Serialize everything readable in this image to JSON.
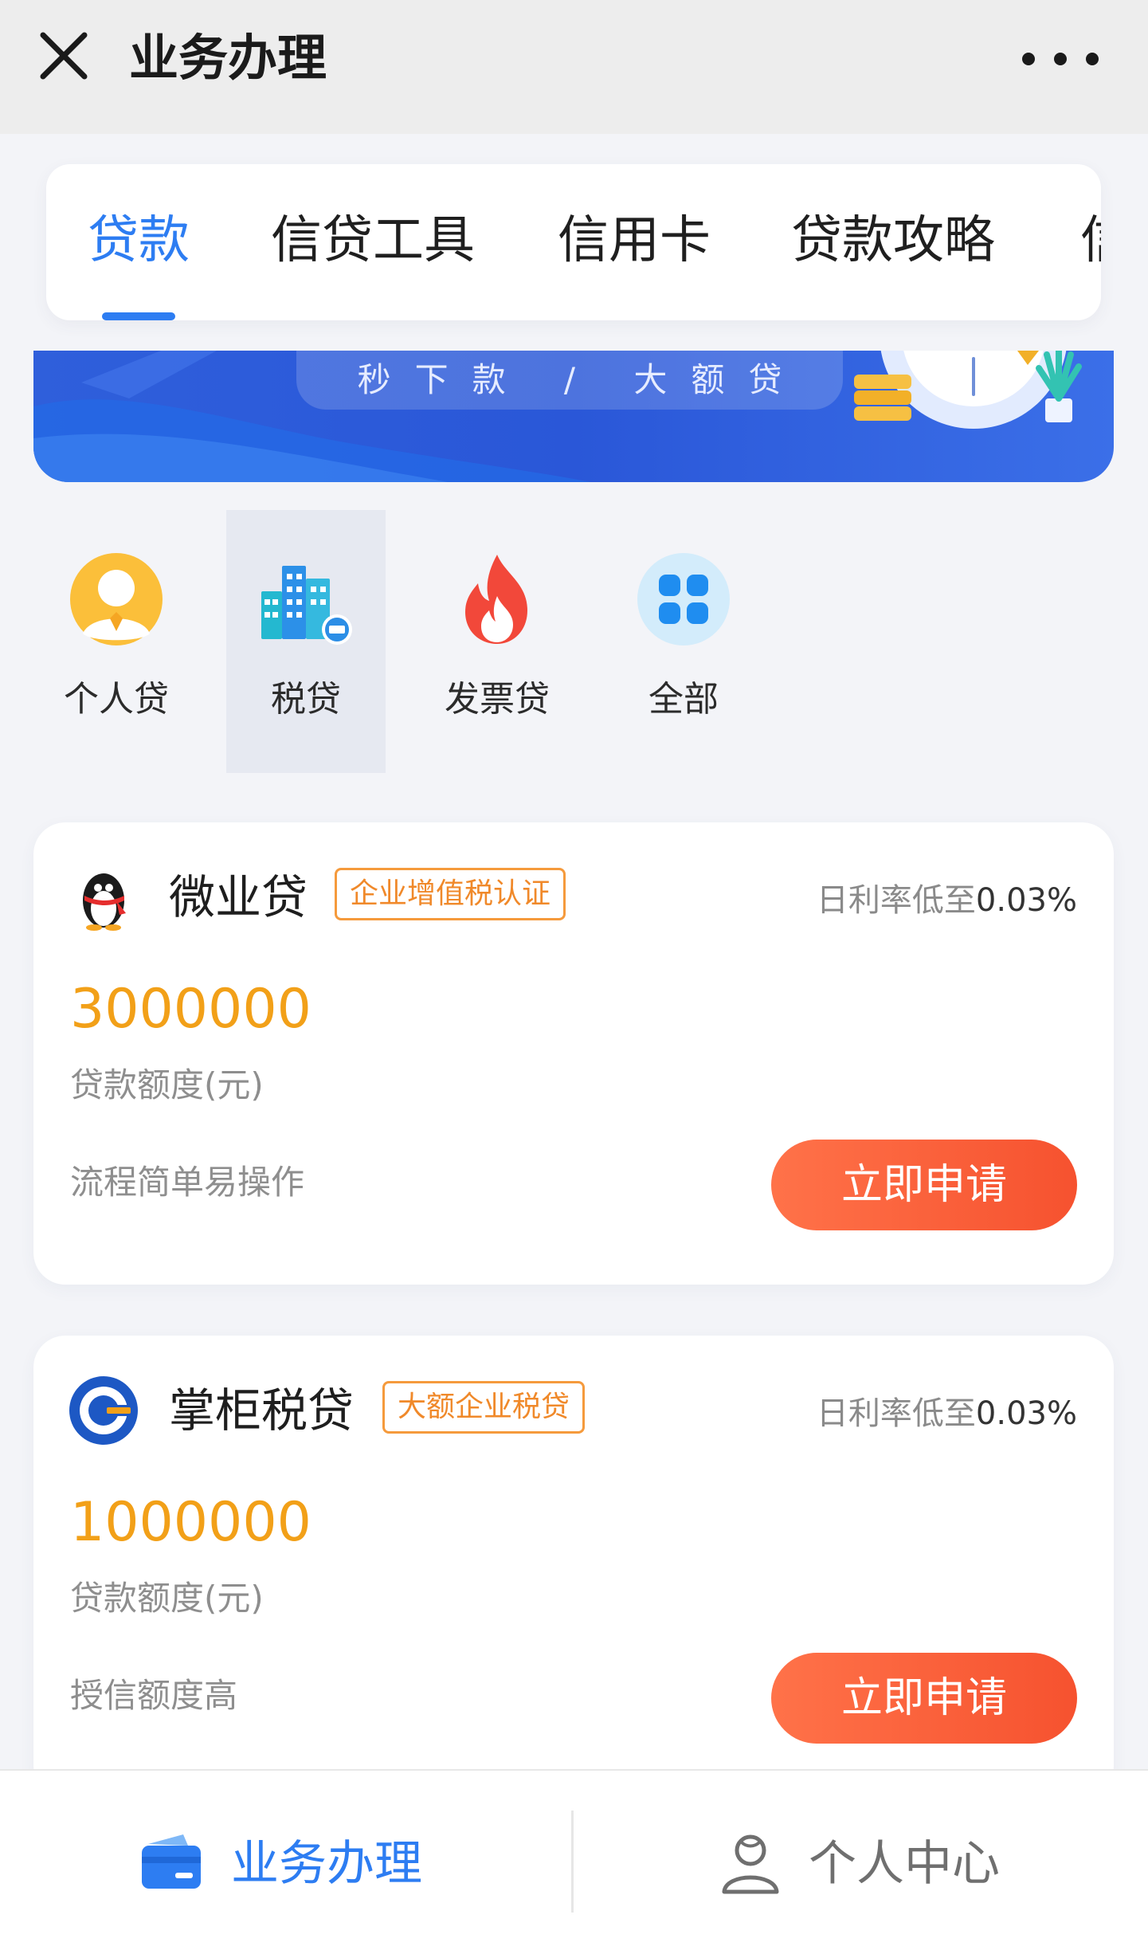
{
  "header": {
    "title": "业务办理",
    "close_icon": "close-icon",
    "more_icon": "more-dots-icon"
  },
  "tabs": [
    {
      "label": "贷款",
      "active": true
    },
    {
      "label": "信贷工具",
      "active": false
    },
    {
      "label": "信用卡",
      "active": false
    },
    {
      "label": "贷款攻略",
      "active": false
    },
    {
      "label": "信",
      "active": false
    }
  ],
  "banner": {
    "slogan": "秒下款 / 大额贷"
  },
  "categories": [
    {
      "label": "个人贷",
      "icon": "person-icon",
      "selected": false
    },
    {
      "label": "税贷",
      "icon": "buildings-icon",
      "selected": true
    },
    {
      "label": "发票贷",
      "icon": "flame-icon",
      "selected": false
    },
    {
      "label": "全部",
      "icon": "grid-icon",
      "selected": false
    }
  ],
  "loans": [
    {
      "name": "微业贷",
      "tag": "企业增值税认证",
      "rate_label": "日利率低至",
      "rate_value": "0.03%",
      "amount": "3000000",
      "amount_label": "贷款额度(元)",
      "feature": "流程简单易操作",
      "apply_label": "立即申请",
      "logo": "penguin-logo-icon"
    },
    {
      "name": "掌柜税贷",
      "tag": "大额企业税贷",
      "rate_label": "日利率低至",
      "rate_value": "0.03%",
      "amount": "1000000",
      "amount_label": "贷款额度(元)",
      "feature": "授信额度高",
      "apply_label": "立即申请",
      "logo": "circle-logo-icon"
    }
  ],
  "bottom_nav": [
    {
      "label": "业务办理",
      "icon": "wallet-icon",
      "active": true
    },
    {
      "label": "个人中心",
      "icon": "user-icon",
      "active": false
    }
  ],
  "colors": {
    "accent_blue": "#2d7df2",
    "amount_orange": "#f2a018",
    "tag_orange": "#f0892a",
    "button_red": "#f6522f",
    "muted_gray": "#8e8e8e",
    "bottom_inactive": "#6f6f6f"
  }
}
